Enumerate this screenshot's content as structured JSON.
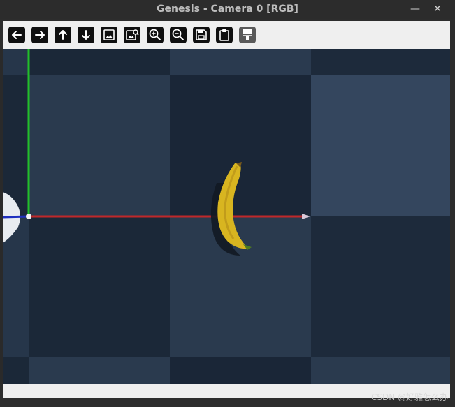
{
  "window": {
    "title": "Genesis - Camera 0 [RGB]",
    "minimize_glyph": "—",
    "close_glyph": "✕"
  },
  "toolbar": {
    "buttons": [
      {
        "name": "back-button",
        "icon": "arrow-left-icon"
      },
      {
        "name": "forward-button",
        "icon": "arrow-right-icon"
      },
      {
        "name": "pan-up-button",
        "icon": "arrow-up-icon"
      },
      {
        "name": "pan-down-button",
        "icon": "arrow-down-icon"
      },
      {
        "name": "image-button",
        "icon": "image-icon"
      },
      {
        "name": "image-search-button",
        "icon": "image-search-icon"
      },
      {
        "name": "zoom-in-button",
        "icon": "zoom-in-icon"
      },
      {
        "name": "zoom-out-button",
        "icon": "zoom-out-icon"
      },
      {
        "name": "save-button",
        "icon": "save-icon"
      },
      {
        "name": "clipboard-button",
        "icon": "clipboard-icon"
      },
      {
        "name": "paint-button",
        "icon": "paint-roller-icon"
      }
    ]
  },
  "scene": {
    "floor_colors": [
      "#1b2839",
      "#2a3a4e"
    ],
    "axis_colors": {
      "x": "#c0282a",
      "y": "#22c02a",
      "z": "#2030c0"
    },
    "object": "banana",
    "banana_color": "#d8b520"
  },
  "watermark": "CSDN @好雅怎么办"
}
